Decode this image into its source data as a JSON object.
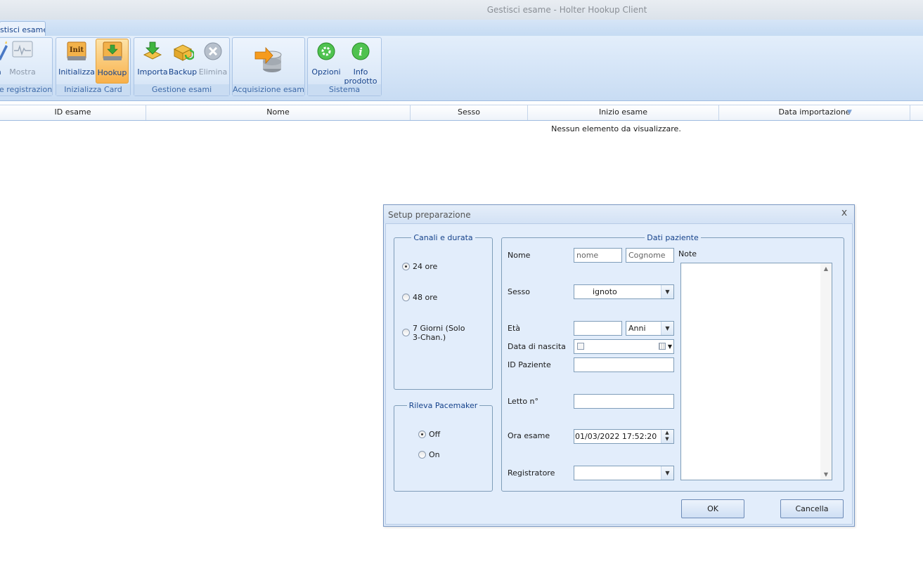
{
  "window": {
    "title": "Gestisci esame  -  Holter Hookup Client"
  },
  "tab": {
    "label": "stisci esame"
  },
  "ribbon": {
    "groups": [
      {
        "label": "e registrazione",
        "buttons": [
          {
            "label": "a",
            "icon": "magic-wand-icon"
          },
          {
            "label": "Mostra",
            "icon": "ecg-monitor-icon"
          }
        ]
      },
      {
        "label": "Inizializza Card",
        "buttons": [
          {
            "label": "Initializza",
            "icon": "init-card-icon",
            "icon_text": "Init"
          },
          {
            "label": "Hookup",
            "icon": "hookup-card-icon"
          }
        ]
      },
      {
        "label": "Gestione esami",
        "buttons": [
          {
            "label": "Importa",
            "icon": "import-icon"
          },
          {
            "label": "Backup",
            "icon": "backup-icon"
          },
          {
            "label": "Elimina",
            "icon": "delete-icon"
          }
        ]
      },
      {
        "label": "Acquisizione esame",
        "buttons": [
          {
            "label": "",
            "icon": "acquire-database-icon"
          }
        ]
      },
      {
        "label": "Sistema",
        "buttons": [
          {
            "label": "Opzioni",
            "icon": "options-gear-icon"
          },
          {
            "label": "Info",
            "label2": "prodotto",
            "icon": "info-icon"
          }
        ]
      }
    ]
  },
  "grid": {
    "columns": [
      "ID esame",
      "Nome",
      "Sesso",
      "Inizio esame",
      "Data importazione"
    ],
    "empty_text": "Nessun elemento da visualizzare."
  },
  "dialog": {
    "title": "Setup preparazione",
    "close": "x",
    "channels": {
      "legend": "Canali e durata",
      "options": [
        "24 ore",
        "48 ore",
        "7 Giorni (Solo",
        "3-Chan.)"
      ],
      "selected": "24 ore"
    },
    "pacemaker": {
      "legend": "Rileva Pacemaker",
      "options": [
        "Off",
        "On"
      ],
      "selected": "Off"
    },
    "patient": {
      "legend": "Dati paziente",
      "nome_label": "Nome",
      "nome_placeholder": "nome",
      "cognome_placeholder": "Cognome",
      "note_label": "Note",
      "sesso_label": "Sesso",
      "sesso_value": "ignoto",
      "eta_label": "Età",
      "eta_unit": "Anni",
      "nascita_label": "Data di nascita",
      "id_label": "ID Paziente",
      "letto_label": "Letto n°",
      "ora_label": "Ora esame",
      "ora_value": "01/03/2022  17:52:20",
      "registratore_label": "Registratore"
    },
    "ok": "OK",
    "cancel": "Cancella"
  },
  "colors": {
    "accent": "#15428b",
    "ribbon": "#dce9f8",
    "active": "#f8b04a"
  }
}
